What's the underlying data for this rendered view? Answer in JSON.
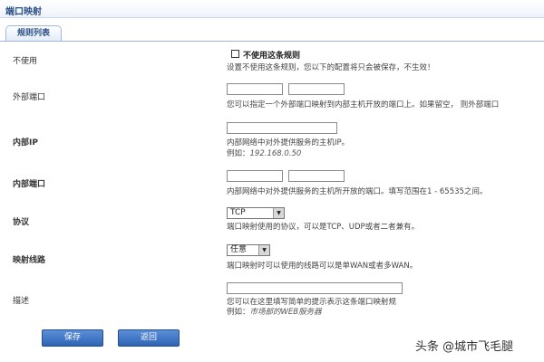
{
  "page": {
    "title": "端口映射"
  },
  "tabs": [
    {
      "label": "规则列表"
    }
  ],
  "form": {
    "disable": {
      "label": "不使用",
      "checkbox_label": "不使用这条规则",
      "help": "设置不使用这条规则，您以下的配置将只会被保存，不生效！"
    },
    "external_port": {
      "label": "外部端口",
      "from_value": "",
      "to_value": "",
      "help": "您可以指定一个外部端口映射到内部主机开放的端口上。如果留空，  则外部端口"
    },
    "internal_ip": {
      "label": "内部IP",
      "value": "",
      "help": "内部网络中对外提供服务的主机IP。",
      "example_prefix": "例如：",
      "example": "192.168.0.50"
    },
    "internal_port": {
      "label": "内部端口",
      "from_value": "",
      "to_value": "",
      "help": "内部网络中对外提供服务的主机所开放的端口。填写范围在1 - 65535之间。"
    },
    "protocol": {
      "label": "协议",
      "selected": "TCP",
      "help": "端口映射使用的协议，可以是TCP、UDP或者二者兼有。"
    },
    "line": {
      "label": "映射线路",
      "selected": "任意",
      "help": "端口映射时可以使用的线路可以是单WAN或者多WAN。"
    },
    "description": {
      "label": "描述",
      "value": "",
      "help": "您可以在这里填写简单的提示表示这条端口映射规",
      "example_prefix": "例如：",
      "example": "市场部的WEB服务器"
    }
  },
  "buttons": {
    "save": "保存",
    "back": "返回"
  },
  "watermark": "头条 @城市飞毛腿",
  "colors": {
    "button": "#3a72c4",
    "title": "#2a4f86"
  }
}
